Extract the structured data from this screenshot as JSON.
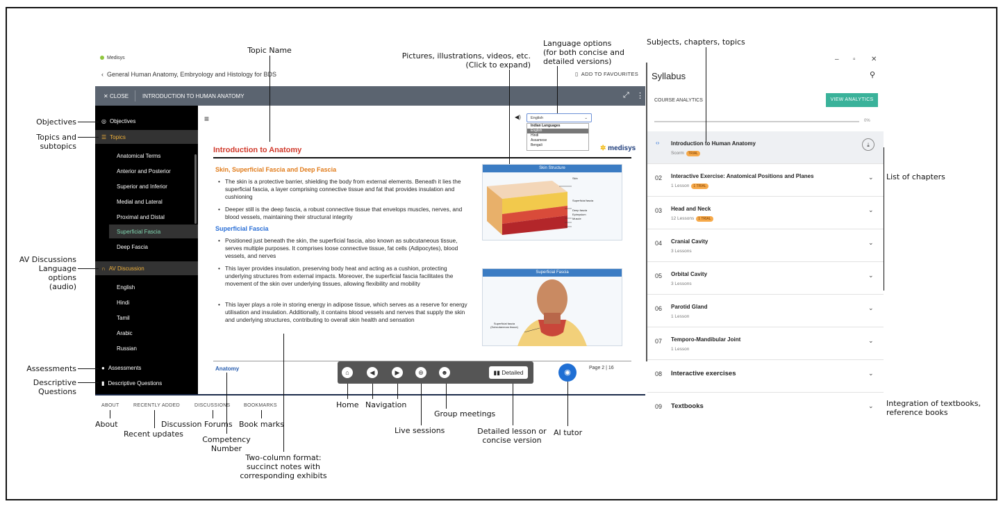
{
  "app": {
    "name": "Medisys",
    "course_title": "General Human Anatomy, Embryology and Histology for BDS",
    "favourites_label": "ADD TO FAVOURITES",
    "close_label": "CLOSE",
    "topic_title": "INTRODUCTION TO HUMAN ANATOMY"
  },
  "sidebar": {
    "objectives": "Objectives",
    "topics": "Topics",
    "subtopics": [
      "Anatomical Terms",
      "Anterior and Posterior",
      "Superior and Inferior",
      "Medial and Lateral",
      "Proximal and Distal",
      "Superficial Fascia",
      "Deep Fascia"
    ],
    "av_discussion": "AV Discussion",
    "languages": [
      "English",
      "Hindi",
      "Tamil",
      "Arabic",
      "Russian"
    ],
    "assessments": "Assessments",
    "descriptive": "Descriptive Questions"
  },
  "content": {
    "language_selected": "English",
    "language_group": "Indian Languages",
    "language_options": [
      "English",
      "Hindi",
      "Assamese",
      "Bengali"
    ],
    "logo": "medisys",
    "heading": "Introduction to Anatomy",
    "section1": "Skin, Superficial Fascia and Deep Fascia",
    "bullets1": [
      "The skin is a protective barrier, shielding the body from external elements. Beneath it lies the superficial fascia, a layer comprising connective tissue and fat that provides insulation and cushioning",
      "Deeper still is the deep fascia, a robust connective tissue that envelops muscles, nerves, and blood vessels, maintaining their structural integrity"
    ],
    "section2": "Superficial Fascia",
    "bullets2": [
      "Positioned just beneath the skin, the superficial fascia, also known as subcutaneous tissue, serves multiple purposes. It comprises loose connective tissue, fat cells (Adipocytes), blood vessels, and nerves",
      "This layer provides insulation, preserving body heat and acting as a cushion, protecting underlying structures from external impacts. Moreover, the superficial fascia facilitates the movement of the skin over underlying tissues, allowing flexibility and mobility",
      "This layer plays a role in storing energy in adipose tissue, which serves as a reserve for energy utilisation and insulation. Additionally, it contains blood vessels and nerves that supply the skin and underlying structures, contributing to overall skin health and sensation"
    ],
    "image1_caption": "Skin Structure",
    "image1_labels": [
      "Skin",
      "Superficial fascia",
      "Deep fascia",
      "Epimysium",
      "Muscle"
    ],
    "image2_caption": "Superficial Fascia",
    "image2_label": "Superficial fascia (Subcutaneous tissue)",
    "footer_label": "Anatomy",
    "page": "Page 2 | 16",
    "detailed_label": "Detailed"
  },
  "bottom_nav": [
    "ABOUT",
    "RECENTLY ADDED",
    "DISCUSSIONS",
    "BOOKMARKS"
  ],
  "syllabus": {
    "title": "Syllabus",
    "course_analytics": "COURSE ANALYTICS",
    "view_analytics": "VIEW ANALYTICS",
    "progress": "0%",
    "chapters": [
      {
        "num": "",
        "name": "Introduction to Human Anatomy",
        "sub": "Scorm",
        "trial": "TRIAL"
      },
      {
        "num": "02",
        "name": "Interactive Exercise: Anatomical Positions and Planes",
        "sub": "1 Lesson",
        "trial": "1 TRIAL"
      },
      {
        "num": "03",
        "name": "Head and Neck",
        "sub": "12 Lessons",
        "trial": "1 TRIAL"
      },
      {
        "num": "04",
        "name": "Cranial Cavity",
        "sub": "3 Lessons",
        "trial": ""
      },
      {
        "num": "05",
        "name": "Orbital Cavity",
        "sub": "3 Lessons",
        "trial": ""
      },
      {
        "num": "06",
        "name": "Parotid Gland",
        "sub": "1 Lesson",
        "trial": ""
      },
      {
        "num": "07",
        "name": "Temporo-Mandibular Joint",
        "sub": "1 Lesson",
        "trial": ""
      },
      {
        "num": "08",
        "name": "Interactive exercises",
        "sub": "",
        "trial": ""
      },
      {
        "num": "09",
        "name": "Textbooks",
        "sub": "",
        "trial": ""
      }
    ]
  },
  "annotations": {
    "topic_name": "Topic Name",
    "pictures": "Pictures, illustrations, videos, etc.\n(Click to expand)",
    "language_options": "Language options\n(for both concise and\ndetailed versions)",
    "subjects": "Subjects, chapters, topics",
    "objectives": "Objectives",
    "topics": "Topics and\nsubtopics",
    "av": "AV Discussions\nLanguage\noptions\n(audio)",
    "assessments": "Assessments",
    "descriptive": "Descriptive\nQuestions",
    "list_of_chapters": "List of chapters",
    "integration": "Integration of textbooks,\nreference books",
    "about": "About",
    "recent": "Recent updates",
    "forums": "Discussion Forums",
    "bookmarks": "Book marks",
    "competency": "Competency\nNumber",
    "two_col": "Two-column format:\nsuccinct notes with\ncorresponding exhibits",
    "home": "Home",
    "navigation": "Navigation",
    "group": "Group meetings",
    "live": "Live sessions",
    "detailed": "Detailed lesson or\nconcise version",
    "ai": "AI tutor"
  }
}
